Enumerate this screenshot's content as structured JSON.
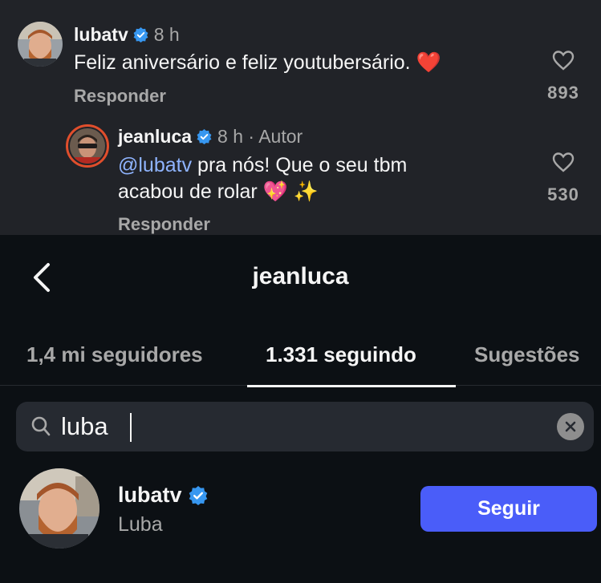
{
  "comments": [
    {
      "username": "lubatv",
      "meta": "8 h",
      "text": "Feliz aniversário e feliz youtubersário. ❤️",
      "reply_label": "Responder",
      "likes": "893"
    },
    {
      "username": "jeanluca",
      "meta": "8 h · Autor",
      "mention": "@lubatv",
      "text_line1": " pra nós! Que o seu tbm",
      "text_line2": "acabou de rolar 💖 ✨",
      "reply_label": "Responder",
      "likes": "530"
    }
  ],
  "header": {
    "title": "jeanluca"
  },
  "tabs": [
    {
      "label": "1,4 mi seguidores",
      "active": false
    },
    {
      "label": "1.331 seguindo",
      "active": true
    },
    {
      "label": "Sugestões",
      "active": false
    }
  ],
  "search": {
    "value": "luba"
  },
  "results": [
    {
      "username": "lubatv",
      "full_name": "Luba",
      "button_label": "Seguir"
    }
  ],
  "colors": {
    "verified": "#3797f0",
    "follow_button": "#4a5df9",
    "background": "#0c1014",
    "comment_bg": "#212328"
  }
}
